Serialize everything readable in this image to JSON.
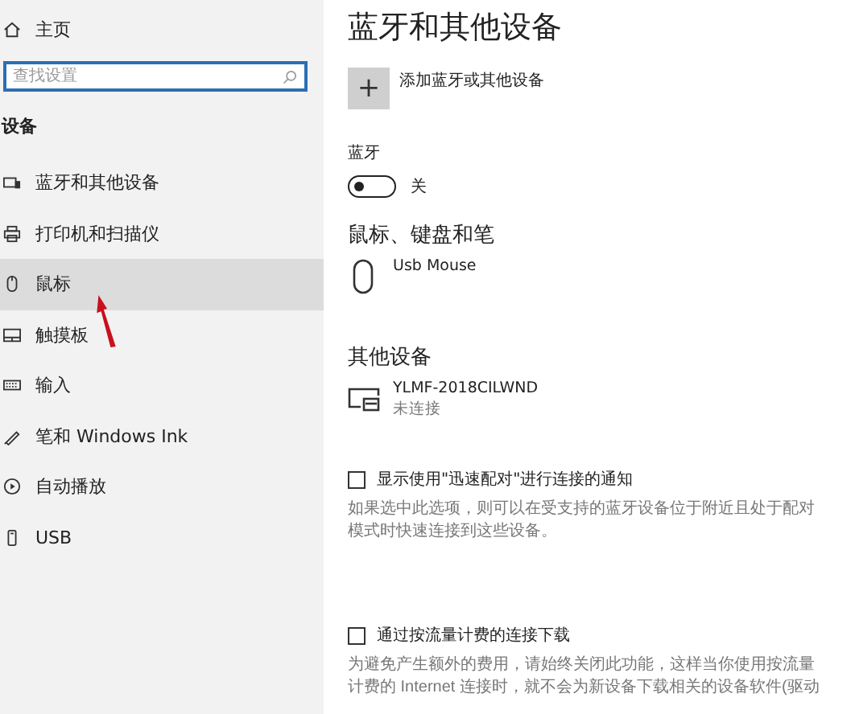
{
  "sidebar": {
    "home": "主页",
    "search": {
      "placeholder": "查找设置"
    },
    "section": "设备",
    "items": [
      {
        "label": "蓝牙和其他设备",
        "selected": false
      },
      {
        "label": "打印机和扫描仪",
        "selected": false
      },
      {
        "label": "鼠标",
        "selected": true
      },
      {
        "label": "触摸板",
        "selected": false
      },
      {
        "label": "输入",
        "selected": false
      },
      {
        "label": "笔和 Windows Ink",
        "selected": false
      },
      {
        "label": "自动播放",
        "selected": false
      },
      {
        "label": "USB",
        "selected": false
      }
    ]
  },
  "main": {
    "title": "蓝牙和其他设备",
    "add_button": {
      "icon": "+",
      "label": "添加蓝牙或其他设备"
    },
    "bluetooth": {
      "label": "蓝牙",
      "on": false,
      "state_text": "关"
    },
    "mouse_section": {
      "heading": "鼠标、键盘和笔",
      "devices": [
        {
          "name": "Usb Mouse"
        }
      ]
    },
    "other_section": {
      "heading": "其他设备",
      "devices": [
        {
          "name": "YLMF-2018CILWND",
          "status": "未连接"
        }
      ]
    },
    "options": [
      {
        "label": "显示使用\"迅速配对\"进行连接的通知",
        "checked": false,
        "description": "如果选中此选项，则可以在受支持的蓝牙设备位于附近且处于配对模式时快速连接到这些设备。"
      },
      {
        "label": "通过按流量计费的连接下载",
        "checked": false,
        "description": "为避免产生额外的费用，请始终关闭此功能，这样当你使用按流量计费的 Internet 连接时，就不会为新设备下载相关的设备软件(驱动"
      }
    ]
  }
}
